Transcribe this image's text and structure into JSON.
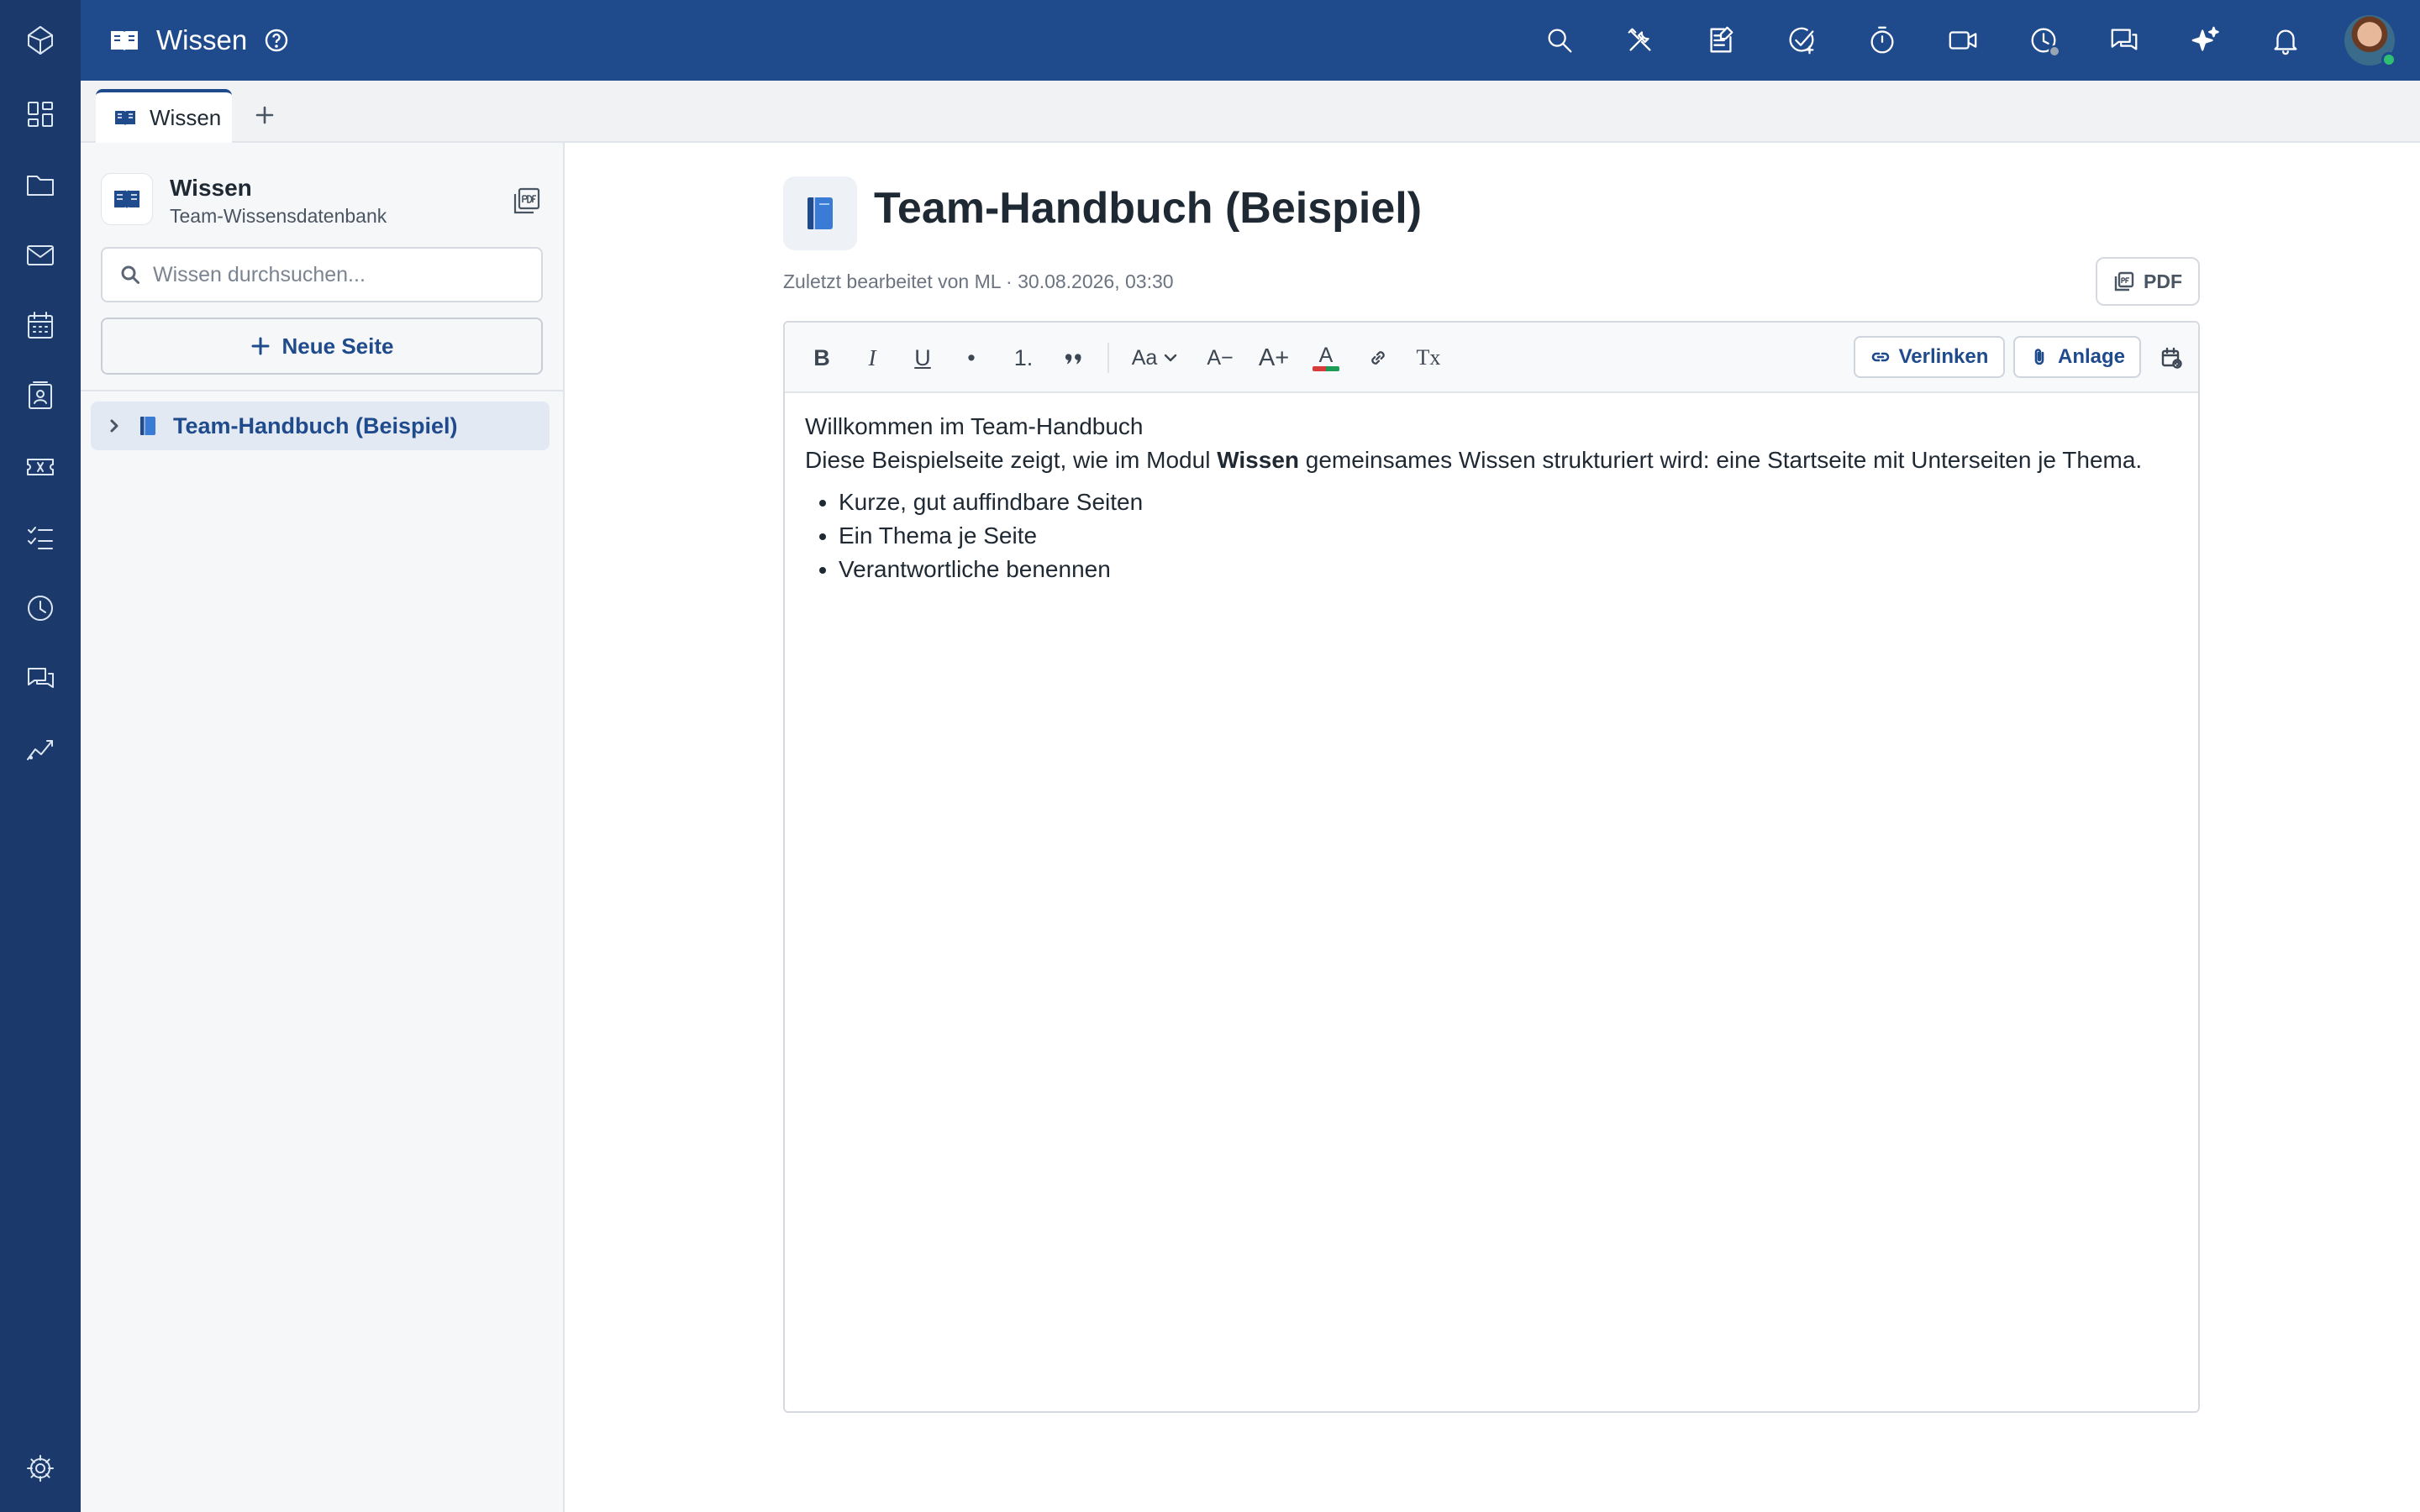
{
  "app": {
    "title": "Wissen",
    "accent_color": "#1f4a8c",
    "rail_color": "#1b3a6b"
  },
  "rail": {
    "items": [
      {
        "icon": "logo-icon"
      },
      {
        "icon": "dashboard-icon"
      },
      {
        "icon": "folder-icon"
      },
      {
        "icon": "mail-icon"
      },
      {
        "icon": "calendar-icon"
      },
      {
        "icon": "contacts-icon"
      },
      {
        "icon": "ticket-icon"
      },
      {
        "icon": "tasks-icon"
      },
      {
        "icon": "clock-icon"
      },
      {
        "icon": "chat-icon"
      },
      {
        "icon": "analytics-icon"
      },
      {
        "icon": "settings-icon"
      }
    ]
  },
  "topbar": {
    "actions": [
      "search-icon",
      "tools-icon",
      "notes-icon",
      "task-check-icon",
      "timer-icon",
      "video-icon",
      "history-icon",
      "messages-icon",
      "ai-sparkle-icon",
      "bell-icon"
    ]
  },
  "tabs": [
    {
      "label": "Wissen",
      "active": true
    }
  ],
  "sidebar": {
    "kb_title": "Wissen",
    "kb_subtitle": "Team-Wissensdatenbank",
    "search_placeholder": "Wissen durchsuchen...",
    "new_page_label": "Neue Seite",
    "tree": [
      {
        "label": "Team-Handbuch (Beispiel)",
        "selected": true,
        "collapsed": true
      }
    ]
  },
  "page": {
    "title": "Team-Handbuch (Beispiel)",
    "meta": "Zuletzt bearbeitet von ML · 30.08.2026, 03:30",
    "pdf_label": "PDF"
  },
  "editor": {
    "toolbar": {
      "bold": "B",
      "italic": "I",
      "underline": "U",
      "bullet": "•",
      "ordered": "1.",
      "font_size": "Aa",
      "smaller": "A−",
      "larger": "A+",
      "text_color_glyph": "A",
      "clear_format": "Tx",
      "link_label": "Verlinken",
      "attach_label": "Anlage"
    },
    "content": {
      "heading_line": "Willkommen im Team-Handbuch",
      "para_before": "Diese Beispielseite zeigt, wie im Modul ",
      "para_bold": "Wissen",
      "para_after": " gemeinsames Wissen strukturiert wird: eine Startseite mit Unterseiten je Thema.",
      "bullets": [
        "Kurze, gut auffindbare Seiten",
        "Ein Thema je Seite",
        "Verantwortliche benennen"
      ]
    }
  }
}
